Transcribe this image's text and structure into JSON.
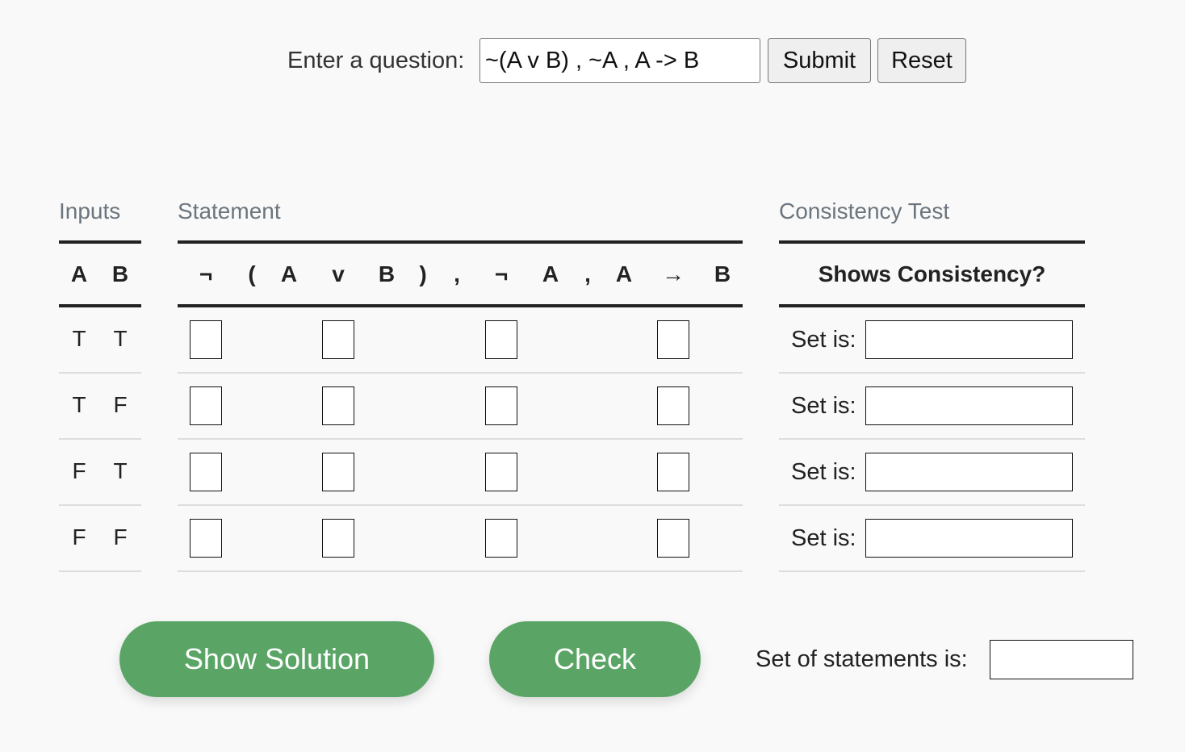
{
  "question": {
    "label": "Enter a question:",
    "value": "~(A v B) , ~A , A -> B",
    "submit_label": "Submit",
    "reset_label": "Reset"
  },
  "sections": {
    "inputs_title": "Inputs",
    "statement_title": "Statement",
    "consistency_title": "Consistency Test"
  },
  "inputs": {
    "headers": [
      "A",
      "B"
    ],
    "rows": [
      [
        "T",
        "T"
      ],
      [
        "T",
        "F"
      ],
      [
        "F",
        "T"
      ],
      [
        "F",
        "F"
      ]
    ]
  },
  "statement": {
    "tokens": [
      "¬",
      "(",
      "A",
      "v",
      "B",
      ")",
      ",",
      "¬",
      "A",
      ",",
      "A",
      "→",
      "B"
    ]
  },
  "consistency": {
    "header": "Shows Consistency?",
    "row_label": "Set is:"
  },
  "footer": {
    "show_solution_label": "Show Solution",
    "check_label": "Check",
    "set_of_statements_label": "Set of statements is:"
  },
  "colors": {
    "accent_green": "#5aa566",
    "section_title": "#6c757d",
    "background": "#f9f9f9"
  }
}
